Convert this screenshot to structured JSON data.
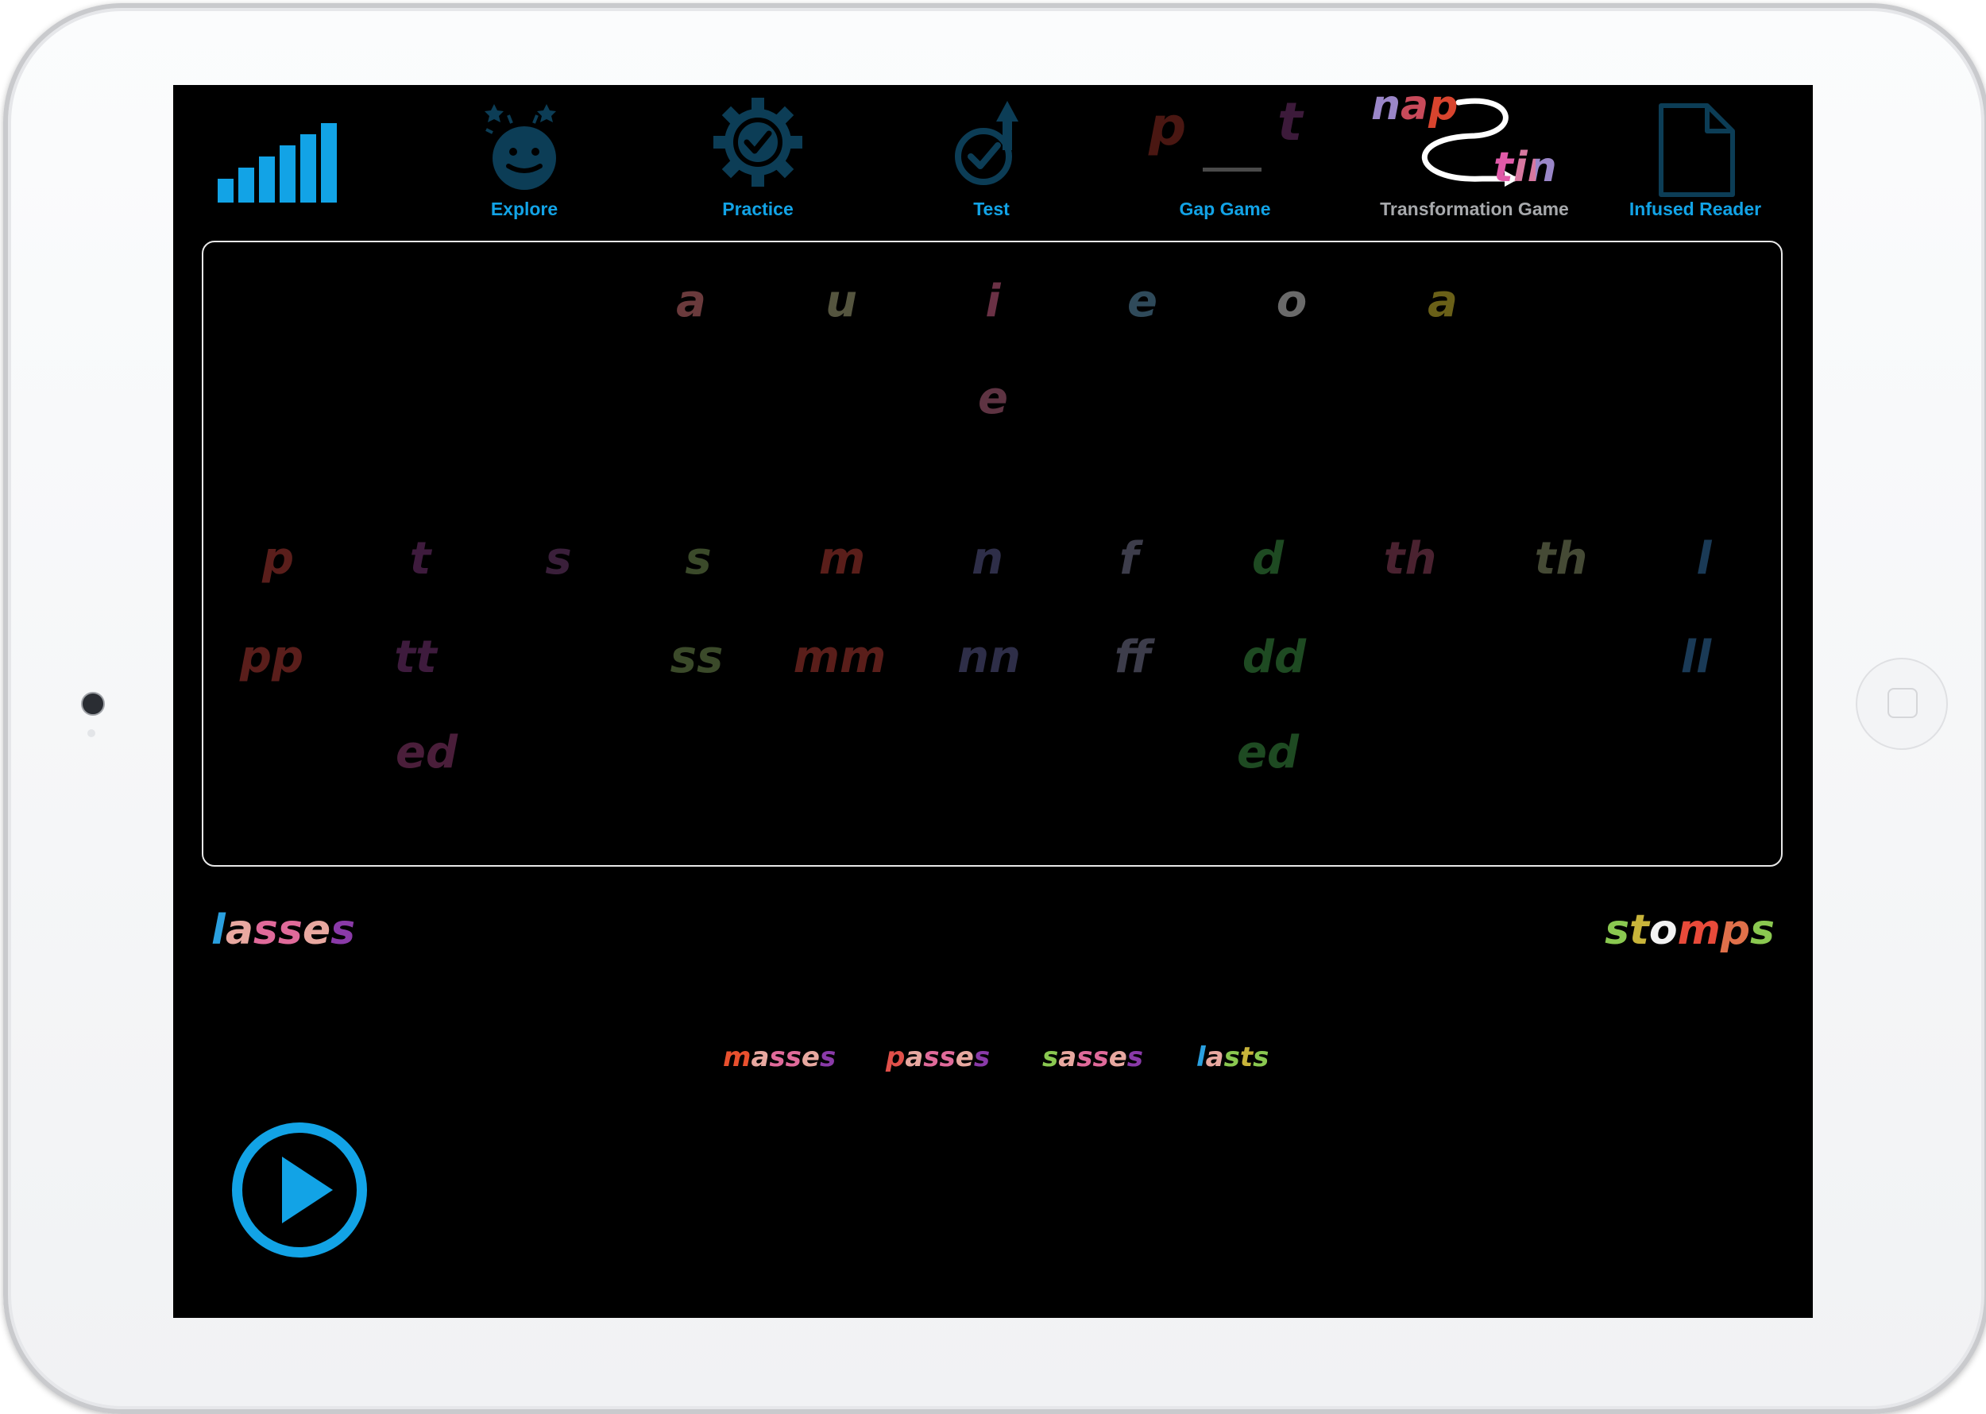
{
  "toolbar": {
    "level_icon": "signal-bars-icon",
    "explore": {
      "label": "Explore",
      "icon": "smiley-face-icon"
    },
    "practice": {
      "label": "Practice",
      "icon": "gear-check-icon"
    },
    "test": {
      "label": "Test",
      "icon": "check-arrow-icon"
    },
    "gap_game": {
      "label": "Gap Game",
      "letter_left": "p",
      "letter_right": "t"
    },
    "transformation_game": {
      "label": "Transformation Game",
      "word_top": "nap",
      "word_bottom": "tin"
    },
    "infused_reader": {
      "label": "Infused Reader",
      "icon": "document-icon"
    },
    "accent_color": "#12a3e6"
  },
  "phonemes": {
    "vowels_row1": [
      {
        "text": "a",
        "color": "#6a3a3c"
      },
      {
        "text": "u",
        "color": "#55553f"
      },
      {
        "text": "i",
        "color": "#6a3145"
      },
      {
        "text": "e",
        "color": "#2f4a5a"
      },
      {
        "text": "o",
        "color": "#6a6a6a"
      },
      {
        "text": "a",
        "color": "#6a6018"
      }
    ],
    "vowels_row2": [
      {
        "text": "e",
        "color": "#5e3342"
      }
    ],
    "consonants_row1": [
      {
        "text": "p",
        "color": "#5a1e1b"
      },
      {
        "text": "t",
        "color": "#3e1b3d"
      },
      {
        "text": "s",
        "color": "#3a1f3a"
      },
      {
        "text": "s",
        "color": "#3b4a2a"
      },
      {
        "text": "m",
        "color": "#5a1e1a"
      },
      {
        "text": "n",
        "color": "#2e2e48"
      },
      {
        "text": "f",
        "color": "#3d3d4b"
      },
      {
        "text": "d",
        "color": "#1e4a22"
      },
      {
        "text": "th",
        "color": "#4a2230"
      },
      {
        "text": "th",
        "color": "#454a35"
      },
      {
        "text": "l",
        "color": "#1a3a56"
      }
    ],
    "consonants_row2": [
      {
        "text": "pp",
        "color": "#5a1e1b"
      },
      {
        "text": "tt",
        "color": "#3e1b3d"
      },
      {
        "text": "ss",
        "color": "#3b4a2a"
      },
      {
        "text": "mm",
        "color": "#5a1e1a"
      },
      {
        "text": "nn",
        "color": "#2e2e48"
      },
      {
        "text": "ff",
        "color": "#3d3d4b"
      },
      {
        "text": "dd",
        "color": "#1e4a22"
      },
      {
        "text": "ll",
        "color": "#1a3a56"
      }
    ],
    "consonants_row3": [
      {
        "text": "ed",
        "color": "#4a1e3a"
      },
      {
        "text": "ed",
        "color": "#1e4a22"
      }
    ]
  },
  "start_word": {
    "letters": [
      {
        "text": "l",
        "color": "#2aa0e0"
      },
      {
        "text": "a",
        "color": "#e8a8a0"
      },
      {
        "text": "ss",
        "color": "#e06a9a"
      },
      {
        "text": "e",
        "color": "#e8a8a0"
      },
      {
        "text": "s",
        "color": "#8a3aa8"
      }
    ]
  },
  "target_word": {
    "letters": [
      {
        "text": "s",
        "color": "#8ac850"
      },
      {
        "text": "t",
        "color": "#c8b43a"
      },
      {
        "text": "o",
        "color": "#f2f2f2"
      },
      {
        "text": "m",
        "color": "#e84a3a"
      },
      {
        "text": "p",
        "color": "#e0704a"
      },
      {
        "text": "s",
        "color": "#8ac850"
      }
    ]
  },
  "history_words": [
    {
      "letters": [
        {
          "text": "m",
          "color": "#e8502e"
        },
        {
          "text": "a",
          "color": "#e8a8a0"
        },
        {
          "text": "ss",
          "color": "#e06a9a"
        },
        {
          "text": "e",
          "color": "#e8a8a0"
        },
        {
          "text": "s",
          "color": "#8a3aa8"
        }
      ]
    },
    {
      "letters": [
        {
          "text": "p",
          "color": "#e0504a"
        },
        {
          "text": "a",
          "color": "#e8a8a0"
        },
        {
          "text": "ss",
          "color": "#e06a9a"
        },
        {
          "text": "e",
          "color": "#e8a8a0"
        },
        {
          "text": "s",
          "color": "#8a3aa8"
        }
      ]
    },
    {
      "letters": [
        {
          "text": "s",
          "color": "#8ac850"
        },
        {
          "text": "a",
          "color": "#e8a8a0"
        },
        {
          "text": "ss",
          "color": "#e06a9a"
        },
        {
          "text": "e",
          "color": "#e8a8a0"
        },
        {
          "text": "s",
          "color": "#8a3aa8"
        }
      ]
    },
    {
      "letters": [
        {
          "text": "l",
          "color": "#2aa0e0"
        },
        {
          "text": "a",
          "color": "#e8a8a0"
        },
        {
          "text": "s",
          "color": "#8ac850"
        },
        {
          "text": "t",
          "color": "#c8b43a"
        },
        {
          "text": "s",
          "color": "#8ac850"
        }
      ]
    }
  ],
  "play_button": {
    "icon": "play-icon",
    "color": "#12a3e6"
  }
}
